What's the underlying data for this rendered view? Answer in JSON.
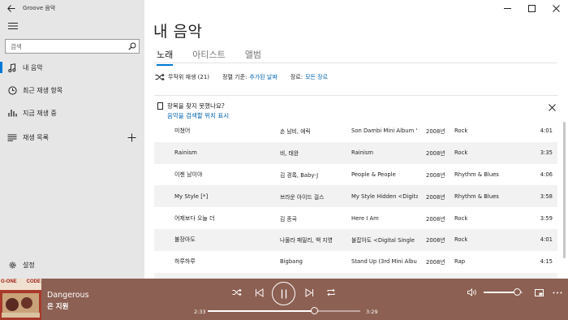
{
  "window": {
    "app_title": "Groove 음악"
  },
  "sidebar": {
    "search_placeholder": "검색",
    "items": [
      {
        "label": "내 음악",
        "icon": "music-note-icon",
        "active": true
      },
      {
        "label": "최근 재생 항목",
        "icon": "clock-icon"
      },
      {
        "label": "지금 재생 중",
        "icon": "bars-chart-icon"
      },
      {
        "label": "재생 목록",
        "icon": "list-icon"
      }
    ],
    "settings_label": "설정"
  },
  "main": {
    "title": "내 음악",
    "tabs": [
      "노래",
      "아티스트",
      "앨범"
    ],
    "active_tab": "노래",
    "toolbar": {
      "shuffle_label": "무작위 재생 (21)",
      "sort_prefix": "정렬 기준:",
      "sort_value": "추가된 날짜",
      "genre_prefix": "장르:",
      "genre_value": "모든 장르"
    },
    "notice": {
      "question": "항목을 찾지 못했나요?",
      "link": "음악을 검색할 위치 표시"
    },
    "songs": [
      {
        "title": "미쳤어",
        "artist": "손 남비, 에릭",
        "album": "Son Dambi Mini Album '",
        "year": "2008년",
        "genre": "Rock",
        "duration": "4:01"
      },
      {
        "title": "Rainism",
        "artist": "비, 태완",
        "album": "Rainism",
        "year": "2008년",
        "genre": "Rock",
        "duration": "3:35"
      },
      {
        "title": "이젠 남이야",
        "artist": "김 경록, Baby-J",
        "album": "People & People",
        "year": "2008년",
        "genre": "Rhythm & Blues",
        "duration": "4:06"
      },
      {
        "title": "My Style [*]",
        "artist": "브라운 아이드 걸스",
        "album": "My Style Hidden <Digita",
        "year": "2008년",
        "genre": "Rhythm & Blues",
        "duration": "3:58"
      },
      {
        "title": "어제보다 오늘 더",
        "artist": "김 종국",
        "album": "Here I Am",
        "year": "2008년",
        "genre": "Rock",
        "duration": "3:59"
      },
      {
        "title": "불장아도",
        "artist": "나물라 패밀리, 백 지영",
        "album": "불잡아도 <Digital Single",
        "year": "2008년",
        "genre": "Rock",
        "duration": "4:01"
      },
      {
        "title": "하루하루",
        "artist": "Bigbang",
        "album": "Stand Up (3rd Mini Albu",
        "year": "2008년",
        "genre": "Rap",
        "duration": "4:15"
      },
      {
        "title": "",
        "artist": "",
        "album": "",
        "year": "",
        "genre": "",
        "duration": ""
      }
    ]
  },
  "player": {
    "track_title": "Dangerous",
    "artist": "은 지원",
    "elapsed": "2:33",
    "total": "3:29",
    "progress": 0.7,
    "volume": 0.86,
    "album_art_text": [
      "G-ONE",
      "CODE"
    ]
  },
  "colors": {
    "accent": "#0078d7",
    "link": "#0063b1",
    "player_bg": "#8c6052",
    "sidebar_bg": "#e6e6e6"
  }
}
